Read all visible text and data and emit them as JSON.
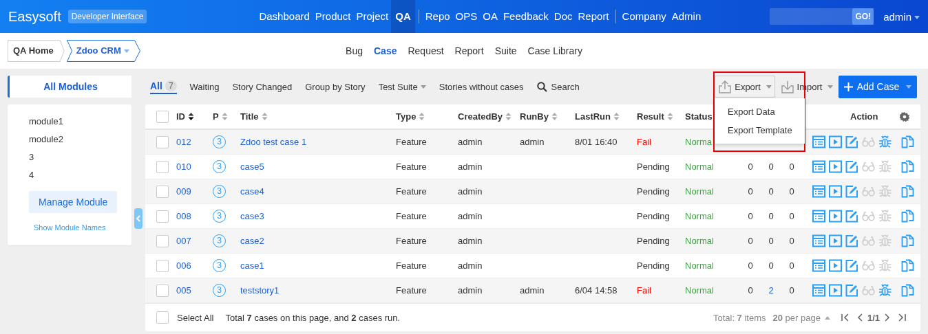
{
  "topbar": {
    "brand": "Easysoft",
    "badge": "Developer Interface",
    "nav": [
      {
        "label": "Dashboard",
        "selected": false,
        "divider_after": false
      },
      {
        "label": "Product",
        "selected": false,
        "divider_after": false
      },
      {
        "label": "Project",
        "selected": false,
        "divider_after": false
      },
      {
        "label": "QA",
        "selected": true,
        "divider_after": true
      },
      {
        "label": "Repo",
        "selected": false,
        "divider_after": false
      },
      {
        "label": "OPS",
        "selected": false,
        "divider_after": false
      },
      {
        "label": "OA",
        "selected": false,
        "divider_after": false
      },
      {
        "label": "Feedback",
        "selected": false,
        "divider_after": false
      },
      {
        "label": "Doc",
        "selected": false,
        "divider_after": false
      },
      {
        "label": "Report",
        "selected": false,
        "divider_after": true
      },
      {
        "label": "Company",
        "selected": false,
        "divider_after": false
      },
      {
        "label": "Admin",
        "selected": false,
        "divider_after": false
      }
    ],
    "search_button": "GO!",
    "user": "admin"
  },
  "subnav": {
    "breadcrumbs": [
      {
        "label": "QA Home",
        "selected": false,
        "dropdown": false
      },
      {
        "label": "Zdoo CRM",
        "selected": true,
        "dropdown": true
      }
    ],
    "menu": [
      {
        "label": "Bug",
        "selected": false
      },
      {
        "label": "Case",
        "selected": true
      },
      {
        "label": "Request",
        "selected": false
      },
      {
        "label": "Report",
        "selected": false
      },
      {
        "label": "Suite",
        "selected": false
      },
      {
        "label": "Case Library",
        "selected": false
      }
    ]
  },
  "sidebar": {
    "title": "All Modules",
    "modules": [
      "module1",
      "module2",
      "3",
      "4"
    ],
    "manage_button": "Manage Module",
    "show_names_link": "Show Module Names"
  },
  "filters": [
    {
      "kind": "tab",
      "label": "All",
      "count": "7",
      "selected": true
    },
    {
      "kind": "tab",
      "label": "Waiting",
      "selected": false
    },
    {
      "kind": "tab",
      "label": "Story Changed",
      "selected": false
    },
    {
      "kind": "tab",
      "label": "Group by Story",
      "selected": false
    },
    {
      "kind": "dropdown",
      "label": "Test Suite",
      "selected": false
    },
    {
      "kind": "tab",
      "label": "Stories without cases",
      "selected": false
    },
    {
      "kind": "search",
      "label": "Search",
      "selected": false
    }
  ],
  "toolbar": {
    "export": {
      "label": "Export",
      "expanded": true,
      "menu": [
        "Export Data",
        "Export Template"
      ]
    },
    "import": "Import",
    "add": "Add Case"
  },
  "table": {
    "columns": [
      {
        "label": "ID",
        "sorted": true
      },
      {
        "label": "P",
        "sorted": false
      },
      {
        "label": "Title",
        "sorted": false
      },
      {
        "label": "Type",
        "sorted": false
      },
      {
        "label": "CreatedBy",
        "sorted": false
      },
      {
        "label": "RunBy",
        "sorted": false
      },
      {
        "label": "LastRun",
        "sorted": false
      },
      {
        "label": "Result",
        "sorted": false
      },
      {
        "label": "Status"
      }
    ],
    "header_checked": false,
    "action_label": "Action",
    "rows": [
      {
        "id": "012",
        "priority": "3",
        "title": "Zdoo test case 1",
        "type": "Feature",
        "created_by": "admin",
        "run_by": "admin",
        "last_run": "8/01 16:40",
        "result": "Fail",
        "failed": true,
        "status": "Norma",
        "bug_active": true,
        "checked": false
      },
      {
        "id": "010",
        "priority": "3",
        "title": "case5",
        "type": "Feature",
        "created_by": "admin",
        "result": "Pending",
        "failed": false,
        "status": "Normal",
        "counts": [
          {
            "text": "0",
            "link": false
          },
          {
            "text": "0",
            "link": false
          },
          {
            "text": "0",
            "link": false
          }
        ],
        "bug_active": false,
        "checked": false
      },
      {
        "id": "009",
        "priority": "3",
        "title": "case4",
        "type": "Feature",
        "created_by": "admin",
        "result": "Pending",
        "failed": false,
        "status": "Normal",
        "counts": [
          {
            "text": "0",
            "link": false
          },
          {
            "text": "0",
            "link": false
          },
          {
            "text": "0",
            "link": false
          }
        ],
        "bug_active": false,
        "checked": false
      },
      {
        "id": "008",
        "priority": "3",
        "title": "case3",
        "type": "Feature",
        "created_by": "admin",
        "result": "Pending",
        "failed": false,
        "status": "Normal",
        "counts": [
          {
            "text": "0",
            "link": false
          },
          {
            "text": "0",
            "link": false
          },
          {
            "text": "0",
            "link": false
          }
        ],
        "bug_active": false,
        "checked": false
      },
      {
        "id": "007",
        "priority": "3",
        "title": "case2",
        "type": "Feature",
        "created_by": "admin",
        "result": "Pending",
        "failed": false,
        "status": "Normal",
        "counts": [
          {
            "text": "0",
            "link": false
          },
          {
            "text": "0",
            "link": false
          },
          {
            "text": "0",
            "link": false
          }
        ],
        "bug_active": false,
        "checked": false
      },
      {
        "id": "006",
        "priority": "3",
        "title": "case1",
        "type": "Feature",
        "created_by": "admin",
        "result": "Pending",
        "failed": false,
        "status": "Normal",
        "counts": [
          {
            "text": "0",
            "link": false
          },
          {
            "text": "0",
            "link": false
          },
          {
            "text": "0",
            "link": false
          }
        ],
        "bug_active": false,
        "checked": false
      },
      {
        "id": "005",
        "priority": "3",
        "title": "teststory1",
        "type": "Feature",
        "created_by": "admin",
        "run_by": "admin",
        "last_run": "6/04 14:58",
        "result": "Fail",
        "failed": true,
        "status": "Normal",
        "counts": [
          {
            "text": "0",
            "link": false
          },
          {
            "text": "2",
            "link": true
          },
          {
            "text": "0",
            "link": false
          }
        ],
        "bug_active": true,
        "checked": false
      }
    ],
    "footer": {
      "select_all": "Select All",
      "select_all_checked": false,
      "summary": "Total **7** cases on this page, and **2** cases run.",
      "total": "Total: **7** items",
      "per_page": "**20** per page",
      "page": "1/1"
    }
  }
}
